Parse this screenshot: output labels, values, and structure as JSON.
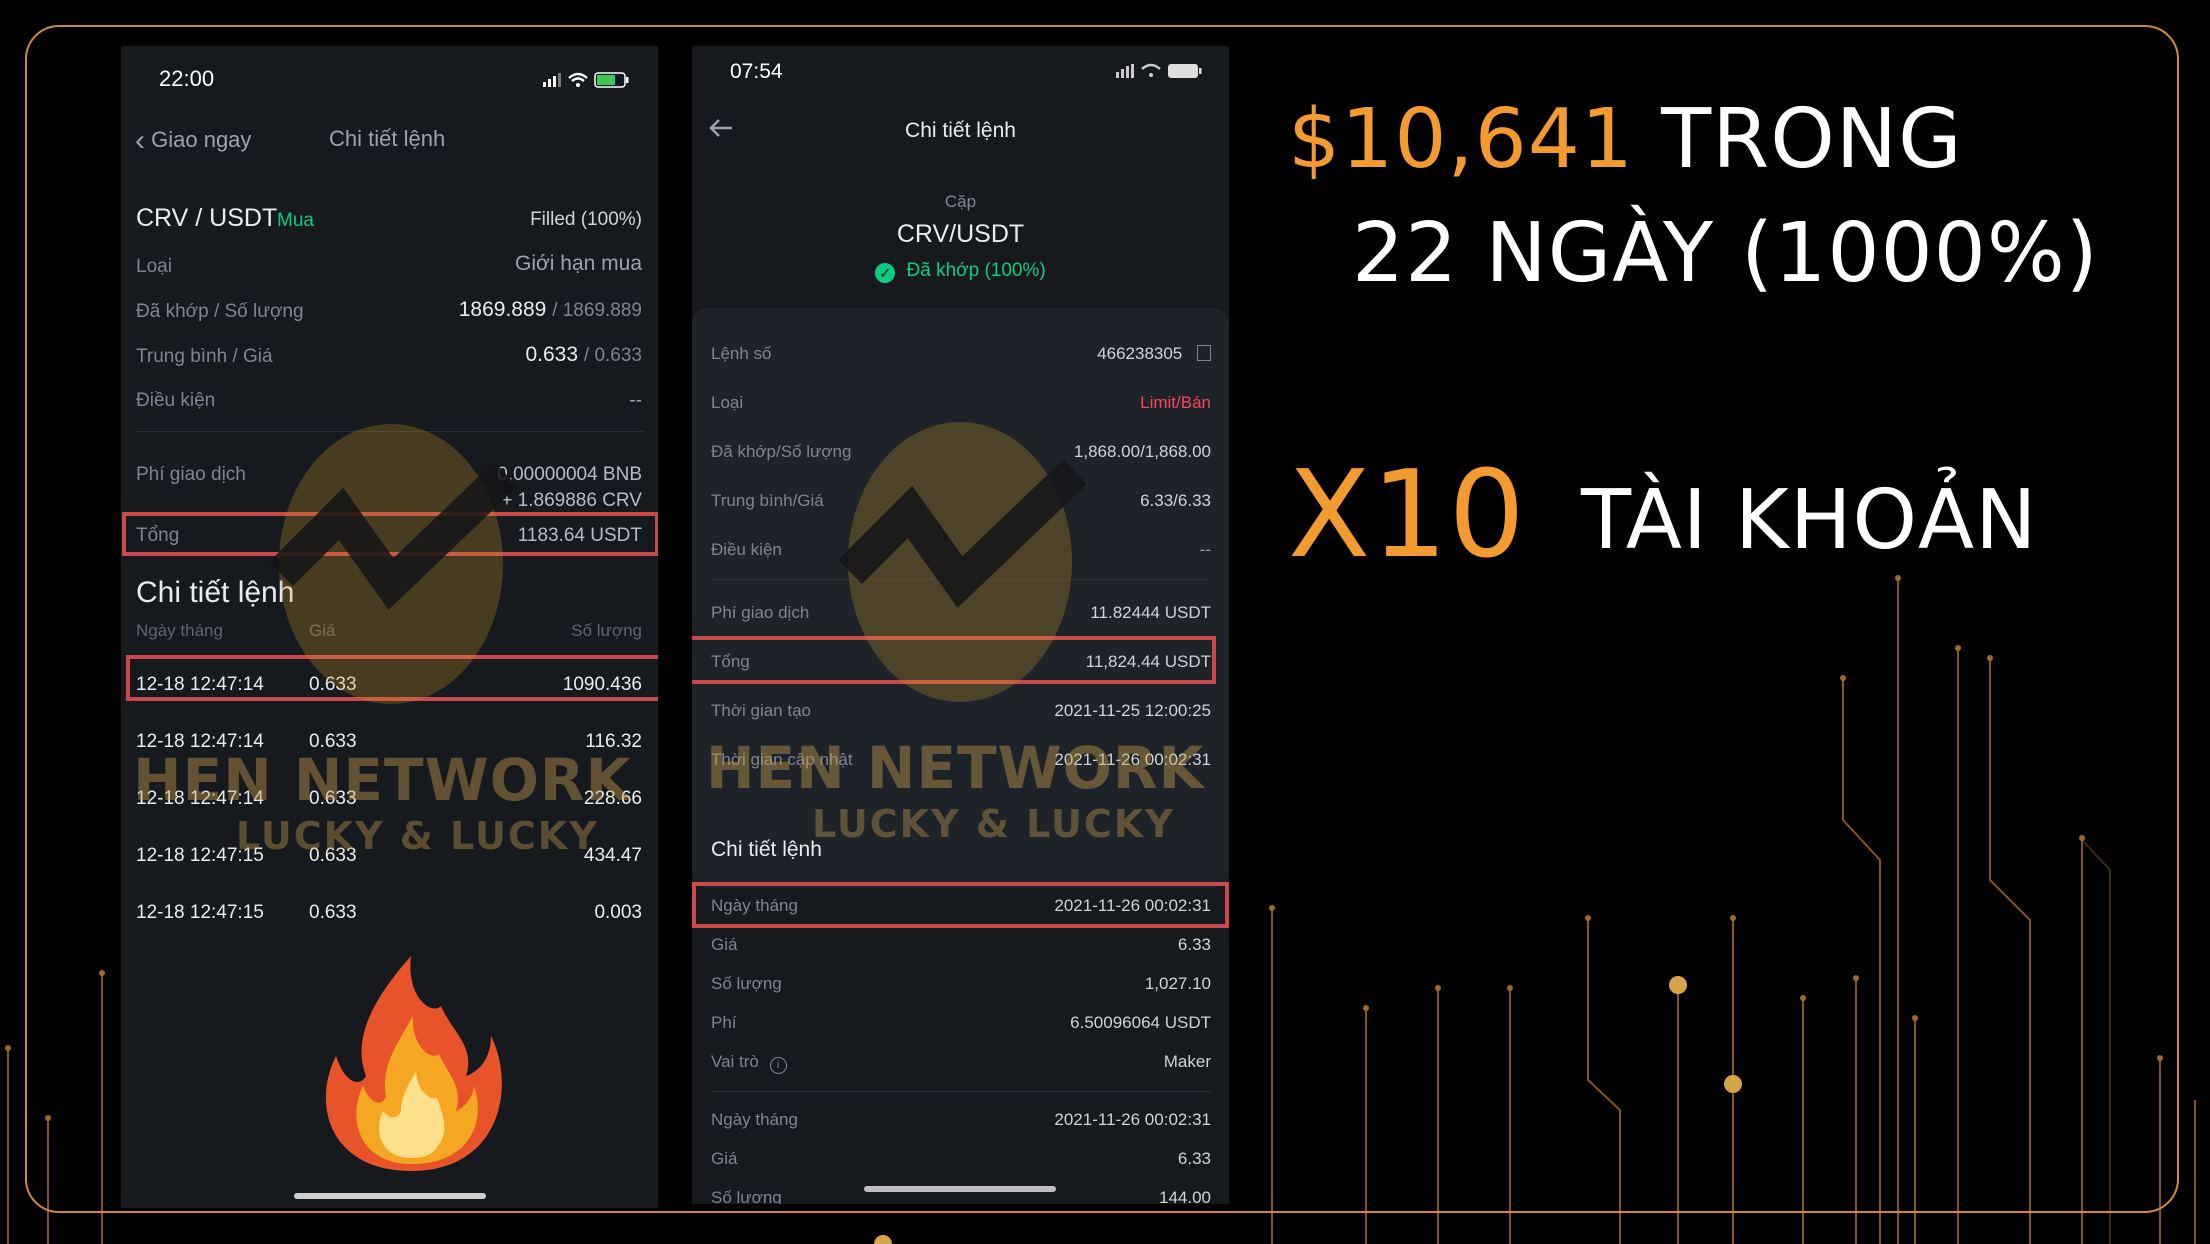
{
  "colors": {
    "accent": "#f39a30",
    "highlight": "#c94a4a",
    "buy_green": "#0ecb81",
    "sell_red": "#f6465d",
    "phone_bg": "#161a1e"
  },
  "headline": {
    "line1_amount": "$10,641",
    "line1_rest": "TRONG",
    "line2": "22 NGÀY (1000%)",
    "x10": "X10",
    "accounts": "TÀI KHOẢN"
  },
  "watermark": {
    "brand": "HEN NETWORK",
    "slogan": "LUCKY & LUCKY"
  },
  "phone1": {
    "time": "22:00",
    "back_label": "Giao ngay",
    "title": "Chi tiết lệnh",
    "pair": "CRV / USDT",
    "side": "Mua",
    "status": "Filled (100%)",
    "rows": {
      "type_label": "Loại",
      "type_value": "Giới hạn mua",
      "filled_label": "Đã khớp / Số lượng",
      "filled_value": "1869.889",
      "filled_total": "/ 1869.889",
      "avg_label": "Trung bình / Giá",
      "avg_value": "0.633",
      "avg_price": "/ 0.633",
      "cond_label": "Điều kiện",
      "cond_value": "--",
      "fee_label": "Phí giao dịch",
      "fee_value1": "0,00000004 BNB",
      "fee_value2": "+ 1.869886 CRV",
      "total_label": "Tổng",
      "total_value": "1183.64 USDT"
    },
    "details_title": "Chi tiết lệnh",
    "col_date": "Ngày tháng",
    "col_price": "Giá",
    "col_qty": "Số lượng",
    "trades": [
      {
        "date": "12-18 12:47:14",
        "price": "0.633",
        "qty": "1090.436"
      },
      {
        "date": "12-18 12:47:14",
        "price": "0.633",
        "qty": "116.32"
      },
      {
        "date": "12-18 12:47:14",
        "price": "0.633",
        "qty": "228.66"
      },
      {
        "date": "12-18 12:47:15",
        "price": "0.633",
        "qty": "434.47"
      },
      {
        "date": "12-18 12:47:15",
        "price": "0.633",
        "qty": "0.003"
      }
    ]
  },
  "phone2": {
    "time": "07:54",
    "title": "Chi tiết lệnh",
    "pair_caption": "Cặp",
    "pair": "CRV/USDT",
    "status": "Đã khớp (100%)",
    "rows": {
      "order_no_label": "Lệnh số",
      "order_no_value": "466238305",
      "type_label": "Loại",
      "type_value": "Limit/Bán",
      "filled_label": "Đã khớp/Số lượng",
      "filled_value": "1,868.00/1,868.00",
      "avg_label": "Trung bình/Giá",
      "avg_value": "6.33/6.33",
      "cond_label": "Điều kiện",
      "cond_value": "--",
      "fee_label": "Phí giao dịch",
      "fee_value": "11.82444 USDT",
      "total_label": "Tổng",
      "total_value": "11,824.44 USDT",
      "created_label": "Thời gian tạo",
      "created_value": "2021-11-25 12:00:25",
      "updated_label": "Thời gian cập nhật",
      "updated_value": "2021-11-26 00:02:31"
    },
    "details_title": "Chi tiết lệnh",
    "detail1": {
      "date_label": "Ngày tháng",
      "date_value": "2021-11-26 00:02:31",
      "price_label": "Giá",
      "price_value": "6.33",
      "qty_label": "Số lượng",
      "qty_value": "1,027.10",
      "fee_label": "Phí",
      "fee_value": "6.50096064 USDT",
      "role_label": "Vai trò",
      "role_value": "Maker"
    },
    "detail2": {
      "date_label": "Ngày tháng",
      "date_value": "2021-11-26 00:02:31",
      "price_label": "Giá",
      "price_value": "6.33",
      "qty_label": "Số lượng",
      "qty_value": "144.00"
    }
  }
}
